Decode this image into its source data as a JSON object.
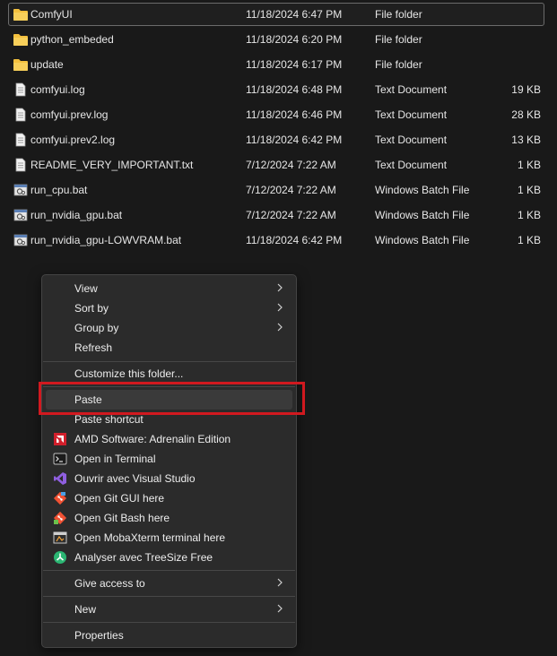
{
  "files": [
    {
      "name": "ComfyUI",
      "date": "11/18/2024 6:47 PM",
      "type": "File folder",
      "size": "",
      "icon": "folder-icon"
    },
    {
      "name": "python_embeded",
      "date": "11/18/2024 6:20 PM",
      "type": "File folder",
      "size": "",
      "icon": "folder-icon"
    },
    {
      "name": "update",
      "date": "11/18/2024 6:17 PM",
      "type": "File folder",
      "size": "",
      "icon": "folder-icon"
    },
    {
      "name": "comfyui.log",
      "date": "11/18/2024 6:48 PM",
      "type": "Text Document",
      "size": "19 KB",
      "icon": "text-document-icon"
    },
    {
      "name": "comfyui.prev.log",
      "date": "11/18/2024 6:46 PM",
      "type": "Text Document",
      "size": "28 KB",
      "icon": "text-document-icon"
    },
    {
      "name": "comfyui.prev2.log",
      "date": "11/18/2024 6:42 PM",
      "type": "Text Document",
      "size": "13 KB",
      "icon": "text-document-icon"
    },
    {
      "name": "README_VERY_IMPORTANT.txt",
      "date": "7/12/2024 7:22 AM",
      "type": "Text Document",
      "size": "1 KB",
      "icon": "text-document-icon"
    },
    {
      "name": "run_cpu.bat",
      "date": "7/12/2024 7:22 AM",
      "type": "Windows Batch File",
      "size": "1 KB",
      "icon": "batch-file-icon"
    },
    {
      "name": "run_nvidia_gpu.bat",
      "date": "7/12/2024 7:22 AM",
      "type": "Windows Batch File",
      "size": "1 KB",
      "icon": "batch-file-icon"
    },
    {
      "name": "run_nvidia_gpu-LOWVRAM.bat",
      "date": "11/18/2024 6:42 PM",
      "type": "Windows Batch File",
      "size": "1 KB",
      "icon": "batch-file-icon"
    }
  ],
  "context_menu": {
    "view": "View",
    "sort_by": "Sort by",
    "group_by": "Group by",
    "refresh": "Refresh",
    "customize": "Customize this folder...",
    "paste": "Paste",
    "paste_shortcut": "Paste shortcut",
    "amd": "AMD Software: Adrenalin Edition",
    "terminal": "Open in Terminal",
    "visual_studio": "Ouvrir avec Visual Studio",
    "git_gui": "Open Git GUI here",
    "git_bash": "Open Git Bash here",
    "mobaxterm": "Open MobaXterm terminal here",
    "treesize": "Analyser avec TreeSize Free",
    "give_access": "Give access to",
    "new": "New",
    "properties": "Properties"
  },
  "colors": {
    "background": "#191919",
    "menu_background": "#2b2b2b",
    "folder": "#f3c03e",
    "highlight_border": "#d1191f",
    "amd": "#d11f2b",
    "visual_studio": "#8f5fe0",
    "git": "#f05133",
    "treesize": "#2bb673"
  }
}
